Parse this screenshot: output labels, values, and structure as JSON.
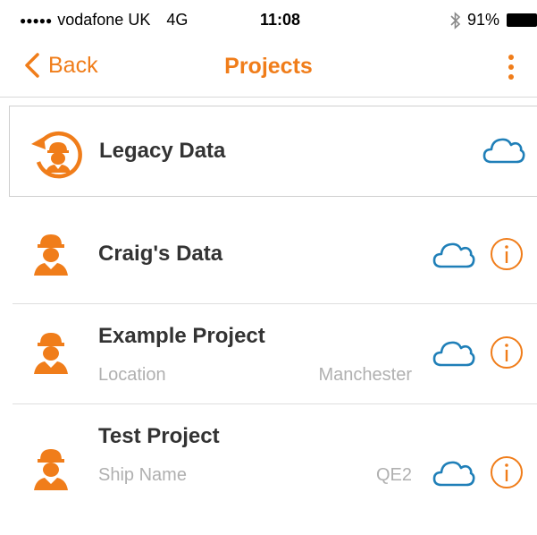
{
  "status_bar": {
    "signal": "●●●●●",
    "carrier": "vodafone UK",
    "network": "4G",
    "time": "11:08",
    "battery": "91%"
  },
  "nav": {
    "back_label": "Back",
    "title": "Projects"
  },
  "projects": [
    {
      "title": "Legacy Data",
      "icon": "legacy-worker-icon"
    },
    {
      "title": "Craig's Data",
      "icon": "worker-icon"
    },
    {
      "title": "Example Project",
      "field_label": "Location",
      "field_value": "Manchester",
      "icon": "worker-icon"
    },
    {
      "title": "Test Project",
      "field_label": "Ship Name",
      "field_value": "QE2",
      "icon": "worker-icon"
    }
  ],
  "colors": {
    "accent": "#F07D1A",
    "cloud": "#1F7FB8",
    "divider": "#DEDEDE",
    "text": "#333333",
    "subtext": "#B0B0B0"
  }
}
